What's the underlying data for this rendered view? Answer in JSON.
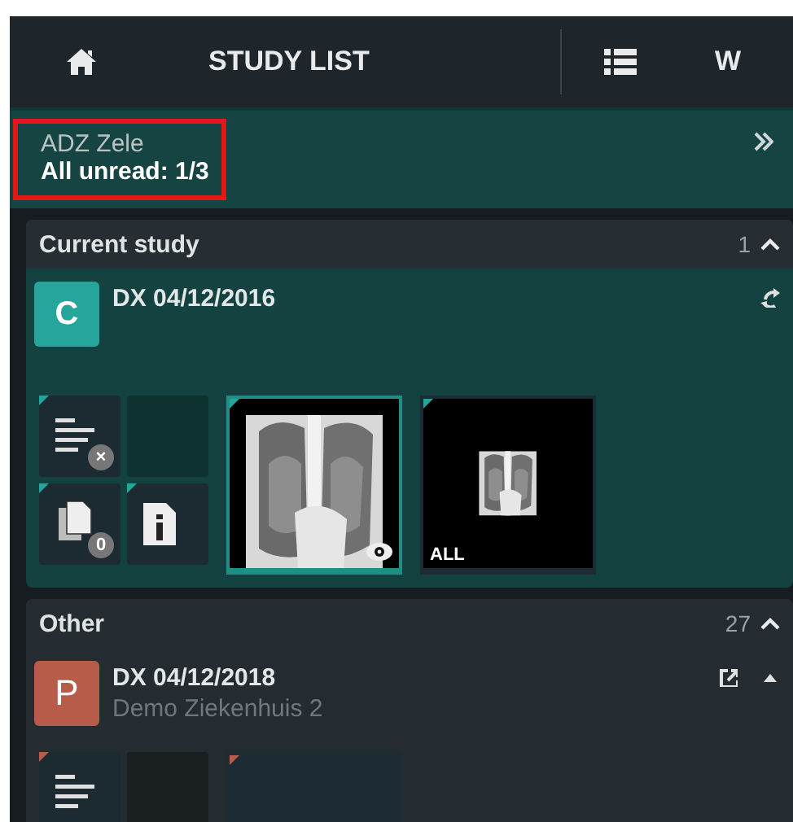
{
  "nav": {
    "title": "STUDY LIST",
    "next_tab": "W"
  },
  "location": {
    "name": "ADZ Zele",
    "unread": "All unread: 1/3",
    "highlighted": true
  },
  "sections": [
    {
      "title": "Current study",
      "count": "1",
      "expanded": true,
      "current": true,
      "studies": [
        {
          "avatar": "C",
          "color": "#26a69a",
          "title": "DX 04/12/2016",
          "actions": [
            {
              "kind": "sync"
            }
          ],
          "thumbnails": [
            {
              "kind": "report",
              "badge": "×"
            },
            {
              "kind": "empty"
            },
            {
              "kind": "document",
              "badge": "0"
            },
            {
              "kind": "info"
            },
            {
              "kind": "xray",
              "selected": true,
              "viewed": true
            },
            {
              "kind": "xray-small",
              "selected": false,
              "label": "ALL"
            }
          ]
        }
      ]
    },
    {
      "title": "Other",
      "count": "27",
      "expanded": true,
      "current": false,
      "studies": [
        {
          "avatar": "P",
          "color": "#b85c4a",
          "title": "DX 04/12/2018",
          "subtitle": "Demo Ziekenhuis 2",
          "actions": [
            {
              "kind": "export"
            },
            {
              "kind": "collapse"
            }
          ],
          "thumbnails": [
            {
              "kind": "report"
            },
            {
              "kind": "empty"
            },
            {
              "kind": "placeholder",
              "selected": false
            }
          ]
        }
      ]
    }
  ]
}
